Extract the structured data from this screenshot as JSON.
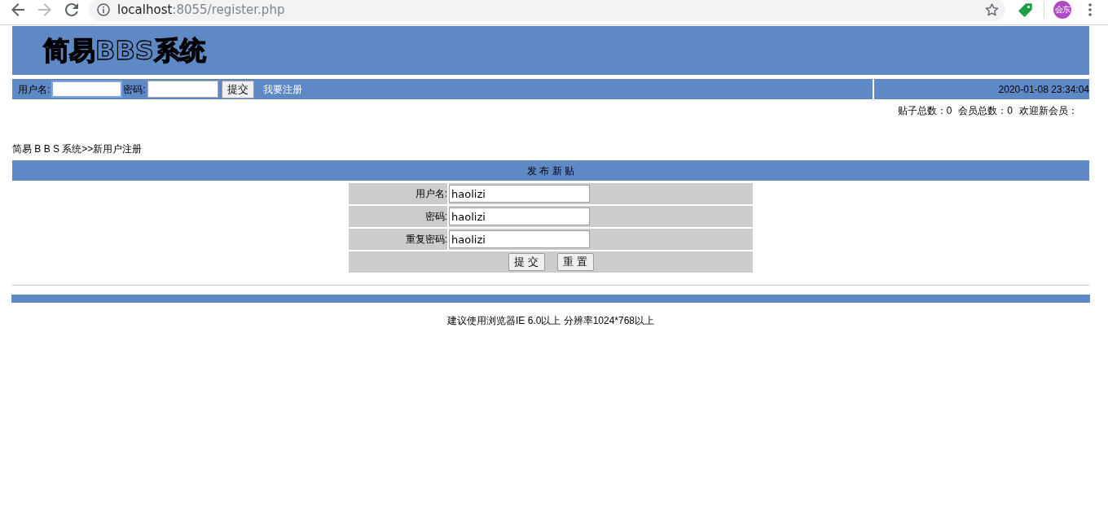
{
  "browser": {
    "back": {
      "disabled": false
    },
    "forward": {
      "disabled": true
    },
    "url": {
      "host": "localhost",
      "path": ":8055/register.php"
    },
    "profile": "会东"
  },
  "header": {
    "logo": "简易BBS系统"
  },
  "login_bar": {
    "fields": [
      {
        "label": "用户名:",
        "focused": true
      },
      {
        "label": "密码:",
        "focused": false
      }
    ],
    "submit": "提交",
    "register_link": "我要注册",
    "datetime": "2020-01-08 23:34:04"
  },
  "stats": [
    "贴子总数：0",
    "会员总数：0",
    "欢迎新会员："
  ],
  "breadcrumb": "简易 B B S 系统>>新用户注册",
  "register_form": {
    "title": "发 布 新 贴",
    "fields": [
      {
        "label": "用户名:",
        "value": "haolizi"
      },
      {
        "label": "密码:",
        "value": "haolizi"
      },
      {
        "label": "重复密码:",
        "value": "haolizi"
      }
    ],
    "buttons": [
      "提 交",
      "重 置"
    ]
  },
  "footer": {
    "note": "建议使用浏览器IE 6.0以上 分辨率1024*768以上"
  }
}
